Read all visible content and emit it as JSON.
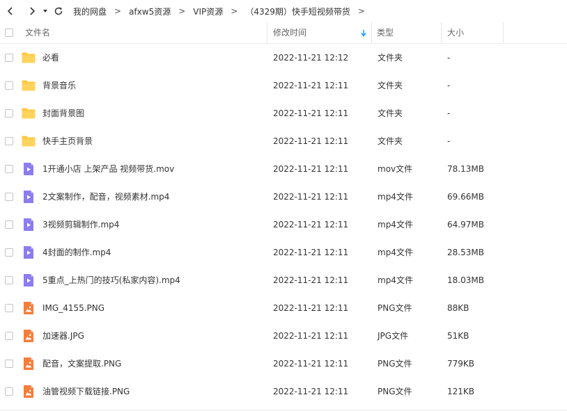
{
  "nav": {
    "back_icon": "chevron-left-icon",
    "forward_icon": "chevron-right-icon",
    "history_icon": "caret-down-icon",
    "refresh_icon": "refresh-icon"
  },
  "breadcrumb": {
    "items": [
      "我的网盘",
      "afxw5资源",
      "VIP资源",
      "（4329期）快手短视频带货"
    ],
    "separator": ">"
  },
  "columns": {
    "name": "文件名",
    "modified": "修改时间",
    "type": "类型",
    "size": "大小",
    "sort_icon": "sort-down-arrow-icon"
  },
  "colors": {
    "folder": "#ffc93c",
    "video": "#8b7cf0",
    "image": "#f57d3a",
    "accent": "#1a9bfc"
  },
  "files": [
    {
      "name": "必看",
      "modified": "2022-11-21 12:12",
      "type": "文件夹",
      "size": "-",
      "icon": "folder"
    },
    {
      "name": "背景音乐",
      "modified": "2022-11-21 12:11",
      "type": "文件夹",
      "size": "-",
      "icon": "folder"
    },
    {
      "name": "封面背景图",
      "modified": "2022-11-21 12:11",
      "type": "文件夹",
      "size": "-",
      "icon": "folder"
    },
    {
      "name": "快手主页背景",
      "modified": "2022-11-21 12:11",
      "type": "文件夹",
      "size": "-",
      "icon": "folder"
    },
    {
      "name": "1开通小店 上架产品 视频带货.mov",
      "modified": "2022-11-21 12:11",
      "type": "mov文件",
      "size": "78.13MB",
      "icon": "video"
    },
    {
      "name": "2文案制作，配音，视频素材.mp4",
      "modified": "2022-11-21 12:11",
      "type": "mp4文件",
      "size": "69.66MB",
      "icon": "video"
    },
    {
      "name": "3视频剪辑制作.mp4",
      "modified": "2022-11-21 12:11",
      "type": "mp4文件",
      "size": "64.97MB",
      "icon": "video"
    },
    {
      "name": "4封面的制作.mp4",
      "modified": "2022-11-21 12:11",
      "type": "mp4文件",
      "size": "28.53MB",
      "icon": "video"
    },
    {
      "name": "5重点_上热门的技巧(私家内容).mp4",
      "modified": "2022-11-21 12:11",
      "type": "mp4文件",
      "size": "18.03MB",
      "icon": "video"
    },
    {
      "name": "IMG_4155.PNG",
      "modified": "2022-11-21 12:11",
      "type": "PNG文件",
      "size": "88KB",
      "icon": "image"
    },
    {
      "name": "加速器.JPG",
      "modified": "2022-11-21 12:11",
      "type": "JPG文件",
      "size": "51KB",
      "icon": "image"
    },
    {
      "name": "配音，文案提取.PNG",
      "modified": "2022-11-21 12:11",
      "type": "PNG文件",
      "size": "779KB",
      "icon": "image"
    },
    {
      "name": "油管视频下载链接.PNG",
      "modified": "2022-11-21 12:11",
      "type": "PNG文件",
      "size": "121KB",
      "icon": "image"
    }
  ]
}
